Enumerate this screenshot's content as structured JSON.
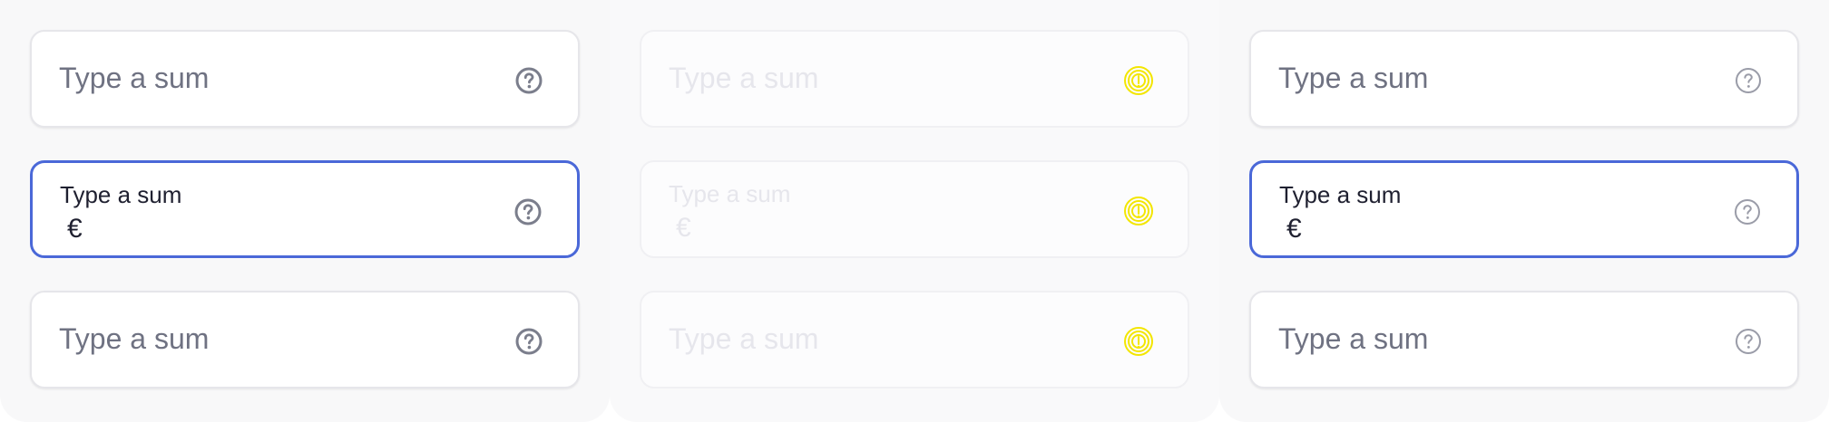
{
  "fields": {
    "placeholder": "Type a sum",
    "label": "Type a sum",
    "currency": "€"
  },
  "icons": {
    "help": "help-icon",
    "warning": "warning-icon"
  },
  "colors": {
    "focus_border": "#4a68d8",
    "text_muted": "#6f7282",
    "text_dark": "#1f2030",
    "disabled_text": "#e6e6ec",
    "warning_icon": "#f3e600"
  }
}
